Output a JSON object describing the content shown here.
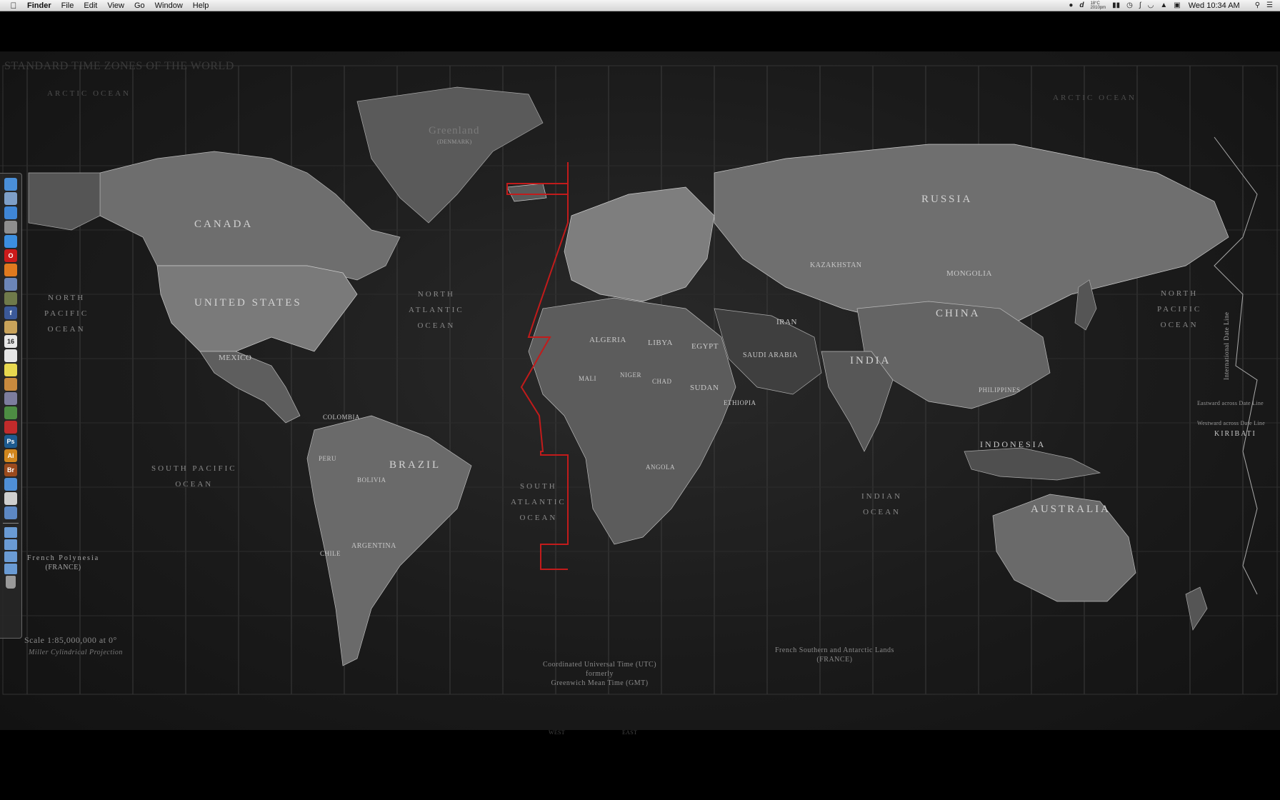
{
  "menubar": {
    "apple_icon": "apple-icon",
    "app_name": "Finder",
    "menus": [
      "File",
      "Edit",
      "View",
      "Go",
      "Window",
      "Help"
    ],
    "weather_temp": "18°C",
    "weather_place": "2010pm",
    "status_icons": [
      "night-owl-icon",
      "dashboard-icon",
      "battery-icon",
      "time-machine-icon",
      "bluetooth-icon",
      "wifi-icon",
      "volume-icon",
      "display-icon"
    ],
    "clock": "Wed 10:34 AM",
    "spotlight_icon": "search-icon",
    "list_icon": "notification-list-icon"
  },
  "map": {
    "title": "STANDARD TIME ZONES OF THE WORLD",
    "countries": {
      "canada": "CANADA",
      "united_states": "UNITED STATES",
      "mexico": "MEXICO",
      "brazil": "BRAZIL",
      "russia": "RUSSIA",
      "china": "CHINA",
      "india": "INDIA",
      "australia": "AUSTRALIA",
      "indonesia": "INDONESIA",
      "algeria": "ALGERIA",
      "libya": "LIBYA",
      "egypt": "EGYPT",
      "sudan": "SUDAN",
      "kazakhstan": "KAZAKHSTAN",
      "mongolia": "MONGOLIA",
      "iran": "IRAN",
      "saudi_arabia": "SAUDI ARABIA",
      "argentina": "ARGENTINA",
      "greenland": "Greenland",
      "greenland_sub": "(DENMARK)",
      "chad": "CHAD",
      "niger": "NIGER",
      "mali": "MALI",
      "angola": "ANGOLA",
      "ethiopia": "ETHIOPIA",
      "philippines": "PHILIPPINES",
      "peru": "PERU",
      "bolivia": "BOLIVIA",
      "colombia": "COLOMBIA",
      "chile": "CHILE",
      "kiribati": "KIRIBATI"
    },
    "oceans": {
      "north_pacific_left": [
        "NORTH",
        "PACIFIC",
        "OCEAN"
      ],
      "north_atlantic": [
        "NORTH",
        "ATLANTIC",
        "OCEAN"
      ],
      "south_pacific": [
        "SOUTH PACIFIC",
        "OCEAN"
      ],
      "south_atlantic": [
        "SOUTH",
        "ATLANTIC",
        "OCEAN"
      ],
      "indian": [
        "INDIAN",
        "OCEAN"
      ],
      "north_pacific_right": [
        "NORTH",
        "PACIFIC",
        "OCEAN"
      ],
      "arctic_left": "ARCTIC OCEAN",
      "arctic_right": "ARCTIC OCEAN"
    },
    "scale": "Scale 1:85,000,000 at 0°",
    "projection": "Miller Cylindrical Projection",
    "utc_label": [
      "Coordinated Universal Time (UTC)",
      "formerly",
      "Greenwich Mean Time (GMT)"
    ],
    "french_southern": [
      "French Southern and Antarctic Lands",
      "(FRANCE)"
    ],
    "french_polynesia": [
      "French Polynesia",
      "(FRANCE)"
    ],
    "dateline_label": "International Date Line",
    "eastward": "Eastward across Date Line",
    "westward": "Westward across Date Line",
    "west": "WEST",
    "east": "EAST"
  },
  "dock": {
    "items": [
      {
        "icon": "finder-icon",
        "label": "",
        "color": "#4a8fd8"
      },
      {
        "icon": "preview-icon",
        "label": "",
        "color": "#7e9fc8"
      },
      {
        "icon": "itunes-icon",
        "label": "",
        "color": "#3f86d6"
      },
      {
        "icon": "system-preferences-icon",
        "label": "",
        "color": "#8e8e8e"
      },
      {
        "icon": "safari-icon",
        "label": "",
        "color": "#3c8fe0"
      },
      {
        "icon": "opera-icon",
        "label": "O",
        "color": "#cc1b1b"
      },
      {
        "icon": "firefox-icon",
        "label": "",
        "color": "#e07a1f"
      },
      {
        "icon": "burn-icon",
        "label": "",
        "color": "#6c86b8"
      },
      {
        "icon": "calculator-icon",
        "label": "",
        "color": "#6f7a4a"
      },
      {
        "icon": "facebook-icon",
        "label": "f",
        "color": "#3b5998"
      },
      {
        "icon": "notebook-icon",
        "label": "",
        "color": "#c9a35a"
      },
      {
        "icon": "calendar-icon",
        "label": "16",
        "color": "#e8e8e8"
      },
      {
        "icon": "textedit-icon",
        "label": "",
        "color": "#e6e6e6"
      },
      {
        "icon": "stickies-icon",
        "label": "",
        "color": "#e8d84f"
      },
      {
        "icon": "photos-icon",
        "label": "",
        "color": "#c98a3e"
      },
      {
        "icon": "automator-icon",
        "label": "",
        "color": "#7d7d9e"
      },
      {
        "icon": "activity-icon",
        "label": "",
        "color": "#4d8d43"
      },
      {
        "icon": "acrobat-icon",
        "label": "",
        "color": "#c22b2b"
      },
      {
        "icon": "photoshop-icon",
        "label": "Ps",
        "color": "#1d5b8f"
      },
      {
        "icon": "illustrator-icon",
        "label": "Ai",
        "color": "#d1861d"
      },
      {
        "icon": "bridge-icon",
        "label": "Br",
        "color": "#9a4a1d"
      },
      {
        "icon": "app-store-icon",
        "label": "",
        "color": "#4f8fd6"
      },
      {
        "icon": "dvd-player-icon",
        "label": "",
        "color": "#cfcfcf"
      },
      {
        "icon": "package-icon",
        "label": "",
        "color": "#5d88c4"
      }
    ],
    "stacks": [
      {
        "icon": "applications-folder-icon",
        "color": "#6a9bd4"
      },
      {
        "icon": "documents-folder-icon",
        "color": "#6a9bd4"
      },
      {
        "icon": "downloads-folder-icon",
        "color": "#6a9bd4"
      },
      {
        "icon": "downloads-stack-icon",
        "color": "#6a9bd4"
      }
    ],
    "trash_icon": "trash-icon"
  }
}
